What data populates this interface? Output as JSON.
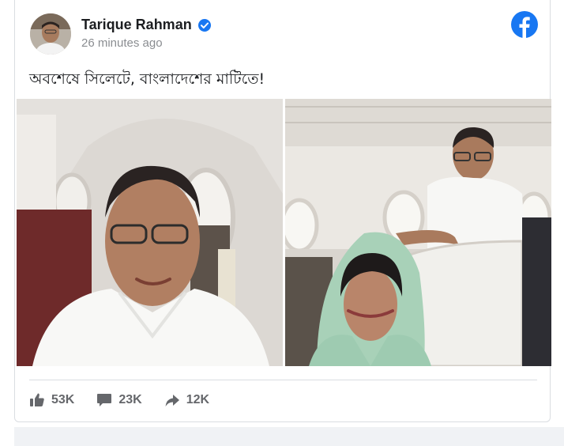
{
  "post": {
    "author": "Tarique Rahman",
    "time": "26 minutes ago",
    "text": "অবশেষে সিলেটে, বাংলাদেশের মাটিতে!"
  },
  "icons": {
    "verified": "verified-badge-icon",
    "platform": "facebook-logo-icon",
    "like": "thumbs-up-icon",
    "comment": "comment-icon",
    "share": "share-arrow-icon"
  },
  "reactions": {
    "likes": "53K",
    "comments": "23K",
    "shares": "12K"
  },
  "colors": {
    "verified": "#1877f2",
    "facebook": "#1877f2",
    "action_text": "#65676b"
  }
}
